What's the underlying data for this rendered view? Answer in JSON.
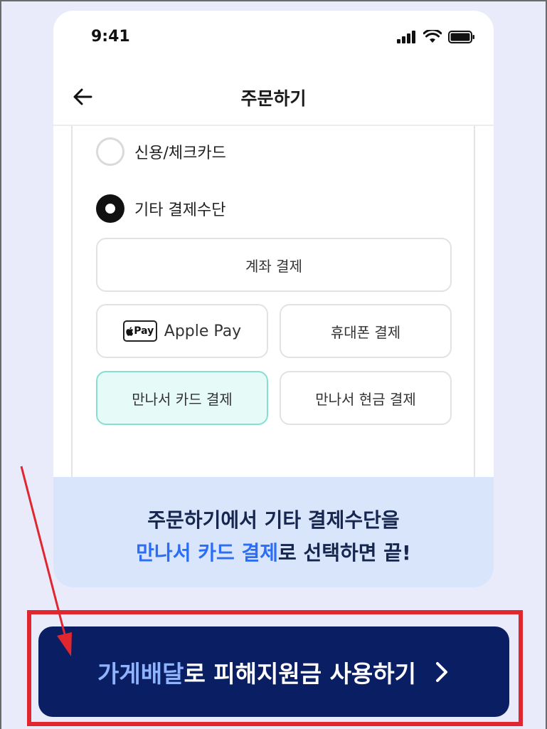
{
  "status_bar": {
    "time": "9:41",
    "signal_icon": "cellular-signal-icon",
    "wifi_icon": "wifi-icon",
    "battery_icon": "battery-icon"
  },
  "nav": {
    "title": "주문하기",
    "back_icon": "back-arrow-icon"
  },
  "payment": {
    "options": [
      {
        "label": "신용/체크카드",
        "checked": false
      },
      {
        "label": "기타 결제수단",
        "checked": true
      }
    ],
    "methods": {
      "bank": "계좌 결제",
      "apple_badge": "Pay",
      "apple": "Apple Pay",
      "phone": "휴대폰 결제",
      "card": "만나서 카드 결제",
      "cash": "만나서 현금 결제"
    },
    "selected_method": "만나서 카드 결제"
  },
  "info": {
    "line1": "주문하기에서 기타 결제수단을",
    "line2_highlight": "만나서 카드 결제",
    "line2_rest": "로 선택하면 끝!"
  },
  "cta": {
    "highlight": "가게배달",
    "rest": "로 피해지원금 사용하기",
    "chevron_icon": "chevron-right-icon"
  },
  "colors": {
    "background": "#e9ebfb",
    "accent_blue": "#2b6df5",
    "navy": "#0a1f63",
    "selected_bg": "#e6fbf7",
    "selected_border": "#86e0d1",
    "info_bg": "#d8e5fb",
    "annotation_red": "#e0262f"
  }
}
